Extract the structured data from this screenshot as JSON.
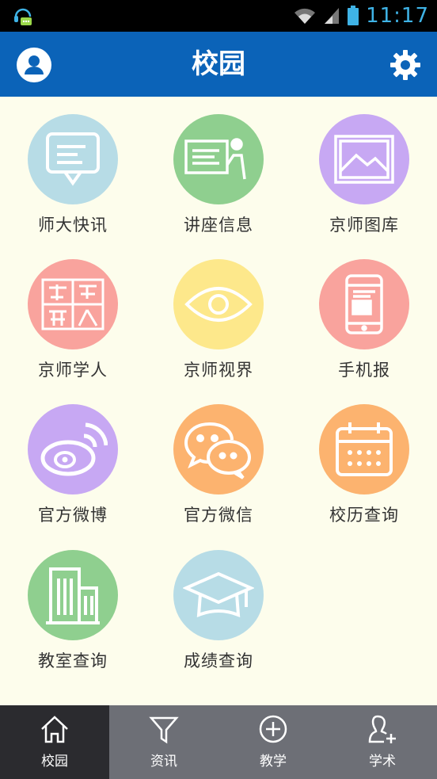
{
  "status_bar": {
    "time": "11:17"
  },
  "header": {
    "title": "校园"
  },
  "colors": {
    "header_bg": "#0b63b8",
    "content_bg": "#fdfdec",
    "tabbar_bg": "#6d6f76",
    "tab_active_bg": "#2b2b2f",
    "blue_light": "#b7dce6",
    "green": "#8fcf8f",
    "purple": "#c7a8f3",
    "salmon": "#f9a39d",
    "yellow": "#fde88b",
    "orange": "#fcb36f"
  },
  "tiles": [
    {
      "label": "师大快讯",
      "icon": "chat-bubble-icon",
      "color": "#b7dce6"
    },
    {
      "label": "讲座信息",
      "icon": "lecture-board-icon",
      "color": "#8fcf8f"
    },
    {
      "label": "京师图库",
      "icon": "picture-icon",
      "color": "#c7a8f3"
    },
    {
      "label": "京师学人",
      "icon": "jingshi-xueren-logo-icon",
      "color": "#f9a39d"
    },
    {
      "label": "京师视界",
      "icon": "eye-icon",
      "color": "#fde88b"
    },
    {
      "label": "手机报",
      "icon": "phone-news-icon",
      "color": "#f9a39d"
    },
    {
      "label": "官方微博",
      "icon": "weibo-icon",
      "color": "#c7a8f3"
    },
    {
      "label": "官方微信",
      "icon": "wechat-icon",
      "color": "#fcb36f"
    },
    {
      "label": "校历查询",
      "icon": "calendar-icon",
      "color": "#fcb36f"
    },
    {
      "label": "教室查询",
      "icon": "building-icon",
      "color": "#8fcf8f"
    },
    {
      "label": "成绩查询",
      "icon": "graduation-cap-icon",
      "color": "#b7dce6"
    }
  ],
  "tabs": [
    {
      "label": "校园",
      "icon": "home-icon",
      "active": true
    },
    {
      "label": "资讯",
      "icon": "filter-icon",
      "active": false
    },
    {
      "label": "教学",
      "icon": "plus-circle-icon",
      "active": false
    },
    {
      "label": "学术",
      "icon": "person-add-icon",
      "active": false
    }
  ]
}
